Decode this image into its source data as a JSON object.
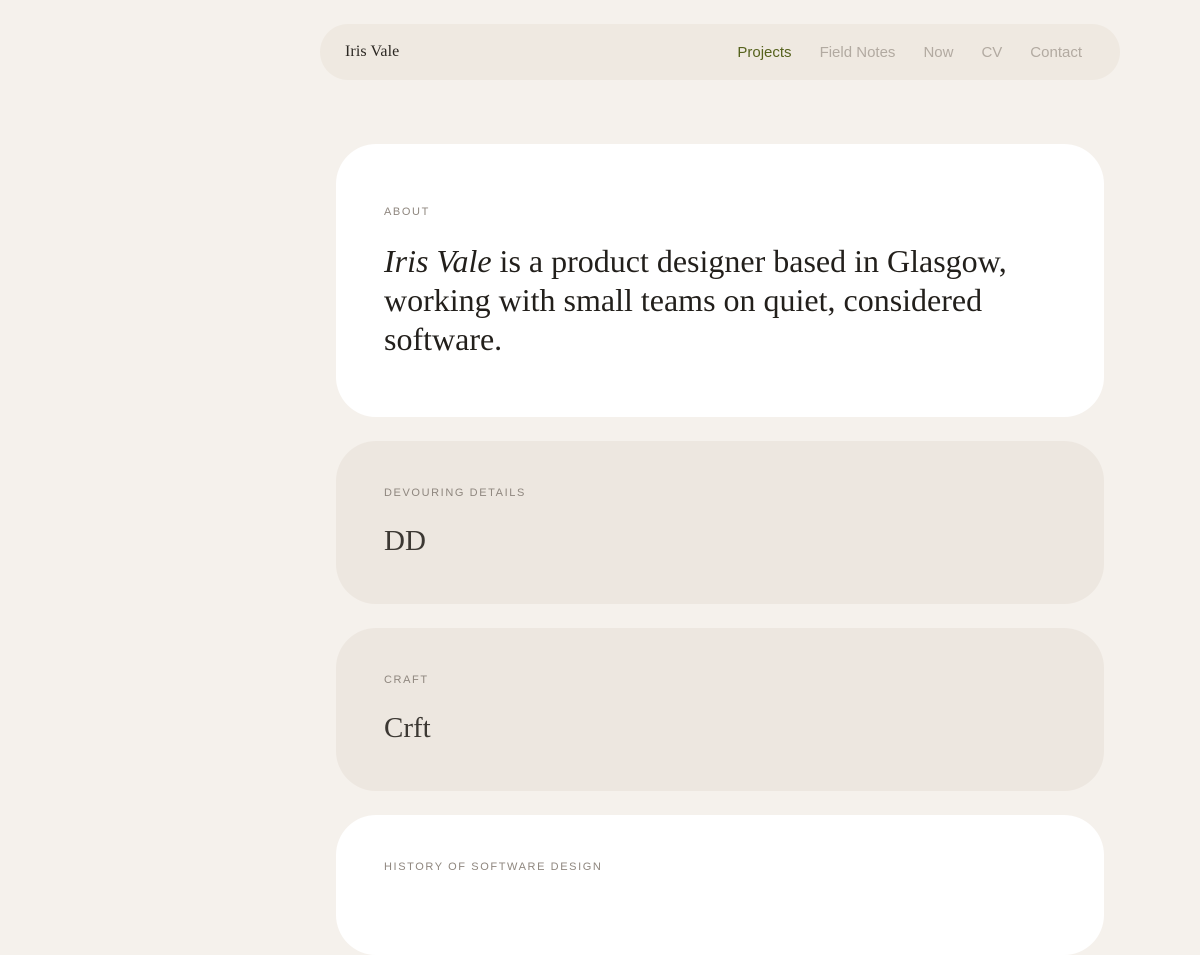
{
  "header": {
    "brand": "Iris Vale",
    "nav": [
      {
        "label": "Projects",
        "active": true
      },
      {
        "label": "Field Notes",
        "active": false
      },
      {
        "label": "Now",
        "active": false
      },
      {
        "label": "CV",
        "active": false
      },
      {
        "label": "Contact",
        "active": false
      }
    ]
  },
  "about": {
    "eyebrow": "About",
    "name": "Iris Vale",
    "text": " is a product designer based in Glasgow, working with small teams on quiet, considered software."
  },
  "sections": [
    {
      "eyebrow": "Devouring Details",
      "heading": "DD"
    },
    {
      "eyebrow": "Craft",
      "heading": "Crft"
    },
    {
      "eyebrow": "History of Software Design"
    }
  ],
  "colors": {
    "page_bg": "#f5f1ec",
    "nav_bg": "#efe9e1",
    "accent": "#56621d",
    "nav_inactive": "#b2aaa1",
    "card_white": "#ffffff",
    "card_tan": "#ede7e0"
  }
}
